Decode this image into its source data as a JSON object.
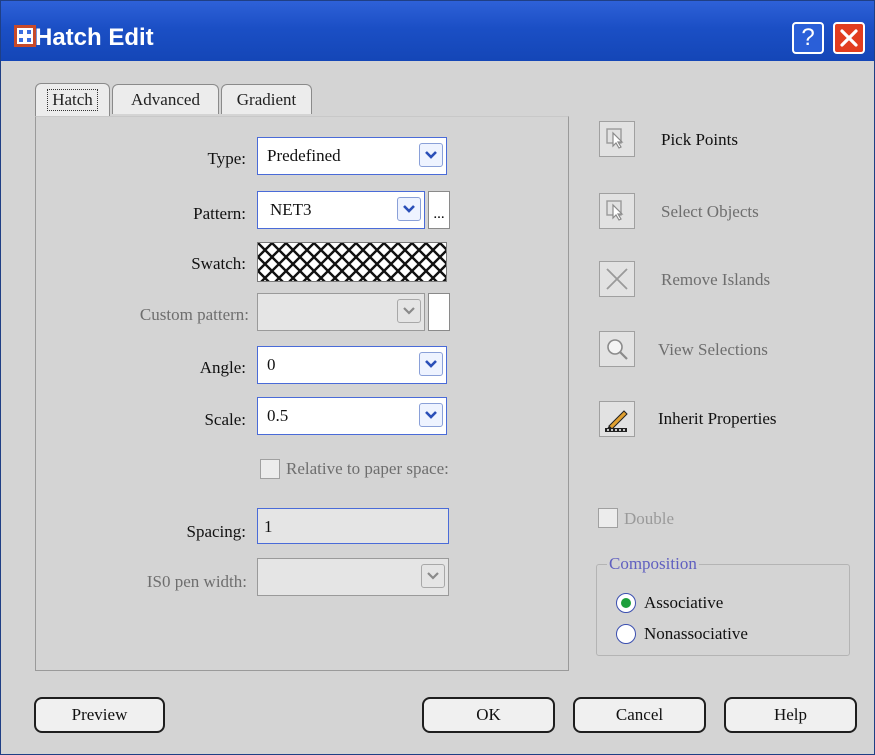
{
  "window": {
    "title": "Hatch Edit",
    "help_label": "?"
  },
  "tabs": [
    {
      "label": "Hatch",
      "active": true
    },
    {
      "label": "Advanced",
      "active": false
    },
    {
      "label": "Gradient",
      "active": false
    }
  ],
  "form": {
    "type": {
      "label": "Type:",
      "value": "Predefined"
    },
    "pattern": {
      "label": "Pattern:",
      "value": "NET3",
      "browse_label": "..."
    },
    "swatch": {
      "label": "Swatch:"
    },
    "custom_pattern": {
      "label": "Custom pattern:",
      "value": ""
    },
    "angle": {
      "label": "Angle:",
      "value": "0"
    },
    "scale": {
      "label": "Scale:",
      "value": "0.5"
    },
    "relative": {
      "label": "Relative to paper space:",
      "checked": false
    },
    "spacing": {
      "label": "Spacing:",
      "value": "1"
    },
    "iso_pen": {
      "label": "IS0 pen width:",
      "value": ""
    }
  },
  "actions": {
    "pick_points": "Pick Points",
    "select_objects": "Select Objects",
    "remove_islands": "Remove Islands",
    "view_selections": "View Selections",
    "inherit_properties": "Inherit Properties"
  },
  "double": {
    "label": "Double",
    "checked": false
  },
  "composition": {
    "title": "Composition",
    "associative": "Associative",
    "nonassociative": "Nonassociative",
    "selected": "associative"
  },
  "buttons": {
    "preview": "Preview",
    "ok": "OK",
    "cancel": "Cancel",
    "help": "Help"
  },
  "colors": {
    "titlebar": "#1b4fc5",
    "close": "#e23d1f",
    "radio_selected": "#1ea03c",
    "group_title": "#6060c0"
  }
}
